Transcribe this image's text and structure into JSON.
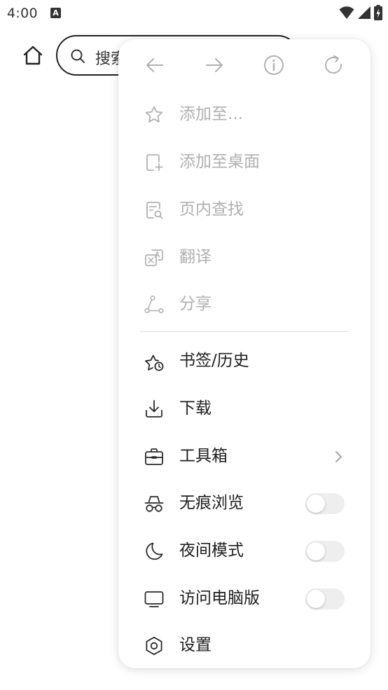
{
  "status_bar": {
    "time": "4:00",
    "notification_icon": "A"
  },
  "address_bar": {
    "search_text": "搜索"
  },
  "menu": {
    "nav": [
      {
        "icon": "back-arrow-icon"
      },
      {
        "icon": "forward-arrow-icon"
      },
      {
        "icon": "info-icon"
      },
      {
        "icon": "refresh-icon"
      }
    ],
    "disabled_items": [
      {
        "label": "添加至...",
        "icon": "star-icon"
      },
      {
        "label": "添加至桌面",
        "icon": "add-to-desktop-icon"
      },
      {
        "label": "页内查找",
        "icon": "find-in-page-icon"
      },
      {
        "label": "翻译",
        "icon": "translate-icon"
      },
      {
        "label": "分享",
        "icon": "share-icon"
      }
    ],
    "items": [
      {
        "label": "书签/历史",
        "icon": "bookmark-history-icon"
      },
      {
        "label": "下载",
        "icon": "download-icon"
      },
      {
        "label": "工具箱",
        "icon": "toolbox-icon",
        "trailing": "chevron-right-icon"
      },
      {
        "label": "无痕浏览",
        "icon": "incognito-icon",
        "toggle": false
      },
      {
        "label": "夜间模式",
        "icon": "moon-icon",
        "toggle": false
      },
      {
        "label": "访问电脑版",
        "icon": "monitor-icon",
        "toggle": false
      },
      {
        "label": "设置",
        "icon": "gear-icon"
      }
    ]
  },
  "colors": {
    "disabled_text": "#b0b0b0",
    "enabled_text": "#1e1e1e",
    "toggle_off": "#eeeeee"
  }
}
